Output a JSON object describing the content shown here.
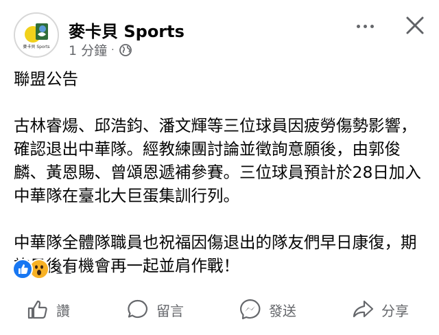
{
  "header": {
    "page_name": "麥卡貝 Sports",
    "timestamp": "1 分鐘",
    "dot": "·",
    "avatar_text": "麥卡貝 Sports"
  },
  "post": {
    "lines": [
      "聯盟公告",
      "",
      "古林睿煬、邱浩鈞、潘文輝等三位球員因疲勞傷勢影響，確認退出中華隊。經教練團討論並徵詢意願後，由郭俊麟、黃恩賜、曾頌恩遞補參賽。三位球員預計於28日加入中華隊在臺北大巨蛋集訓行列。",
      "",
      "中華隊全體隊職員也祝福因傷退出的隊友們早日康復，期許日後有機會再一起並肩作戰！"
    ]
  },
  "reactions": {
    "count": "11"
  },
  "actions": {
    "like": "讚",
    "comment": "留言",
    "send": "發送",
    "share": "分享"
  },
  "colors": {
    "text": "#050505",
    "secondary": "#65676b",
    "like_blue": "#1877f2",
    "wow_yellow": "#f7b125"
  }
}
